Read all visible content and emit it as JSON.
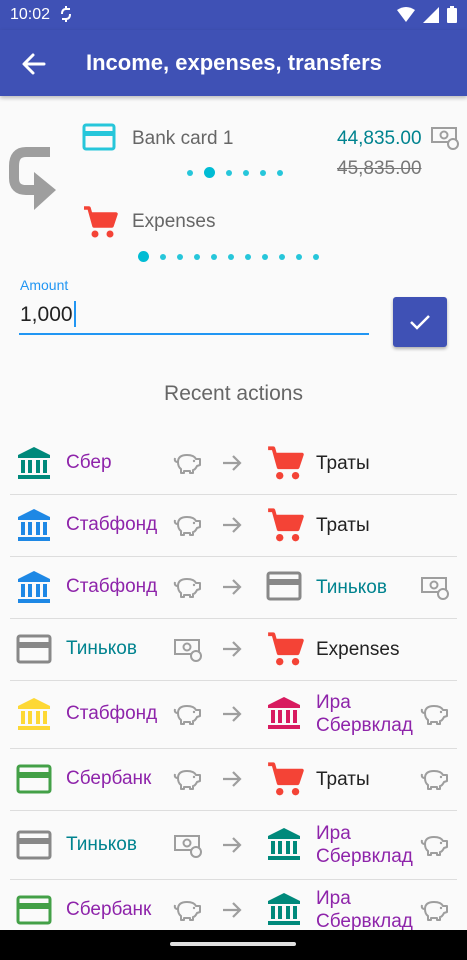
{
  "status": {
    "time": "10:02"
  },
  "header": {
    "title": "Income, expenses, transfers"
  },
  "source": {
    "name": "Bank card 1",
    "balance_new": "44,835.00",
    "balance_old": "45,835.00",
    "pages": 6,
    "current": 1
  },
  "destination": {
    "name": "Expenses",
    "pages": 11,
    "current": 0
  },
  "amount": {
    "label": "Amount",
    "value": "1,000"
  },
  "recent": {
    "title": "Recent actions",
    "rows": [
      {
        "from_icon": "bank-icon",
        "from_color": "#00897b",
        "from": "Сбер",
        "from_style": "purple",
        "via_icon": "piggy-bank-icon",
        "to_icon": "cart-icon",
        "to": "Траты",
        "to_style": "dark",
        "end_icon": ""
      },
      {
        "from_icon": "bank-icon",
        "from_color": "#1e88e5",
        "from": "Стабфонд",
        "from_style": "purple",
        "via_icon": "piggy-bank-icon",
        "to_icon": "cart-icon",
        "to": "Траты",
        "to_style": "dark",
        "end_icon": ""
      },
      {
        "from_icon": "bank-icon",
        "from_color": "#1e88e5",
        "from": "Стабфонд",
        "from_style": "purple",
        "via_icon": "piggy-bank-icon",
        "to_icon": "card-icon",
        "to_color": "#888888",
        "to": "Тиньков",
        "to_style": "teal",
        "end_icon": "money-icon"
      },
      {
        "from_icon": "card-icon",
        "from_color": "#888888",
        "from": "Тиньков",
        "from_style": "teal",
        "via_icon": "money-icon",
        "to_icon": "cart-icon",
        "to": "Expenses",
        "to_style": "dark",
        "end_icon": ""
      },
      {
        "from_icon": "bank-icon",
        "from_color": "#fdd835",
        "from": "Стабфонд",
        "from_style": "purple",
        "via_icon": "piggy-bank-icon",
        "to_icon": "bank-icon",
        "to_color": "#d81b60",
        "to": "Ира Сбервклад",
        "to_style": "purple",
        "end_icon": "piggy-bank-icon"
      },
      {
        "from_icon": "card-icon",
        "from_color": "#43a047",
        "from": "Сбербанк",
        "from_style": "purple",
        "via_icon": "piggy-bank-icon",
        "to_icon": "cart-icon",
        "to": "Траты",
        "to_style": "dark",
        "end_icon": "piggy-bank-icon"
      },
      {
        "from_icon": "card-icon",
        "from_color": "#888888",
        "from": "Тиньков",
        "from_style": "teal",
        "via_icon": "money-icon",
        "to_icon": "bank-icon",
        "to_color": "#00897b",
        "to": "Ира Сбервклад",
        "to_style": "purple",
        "end_icon": "piggy-bank-icon"
      },
      {
        "from_icon": "card-icon",
        "from_color": "#43a047",
        "from": "Сбербанк",
        "from_style": "purple",
        "via_icon": "piggy-bank-icon",
        "to_icon": "bank-icon",
        "to_color": "#00897b",
        "to": "Ира Сбервклад",
        "to_style": "purple",
        "end_icon": "piggy-bank-icon"
      }
    ]
  },
  "colors": {
    "primary": "#3f51b5",
    "accent": "#2196f3",
    "teal": "#00838f",
    "purple": "#8e24aa",
    "cart": "#f44336"
  }
}
